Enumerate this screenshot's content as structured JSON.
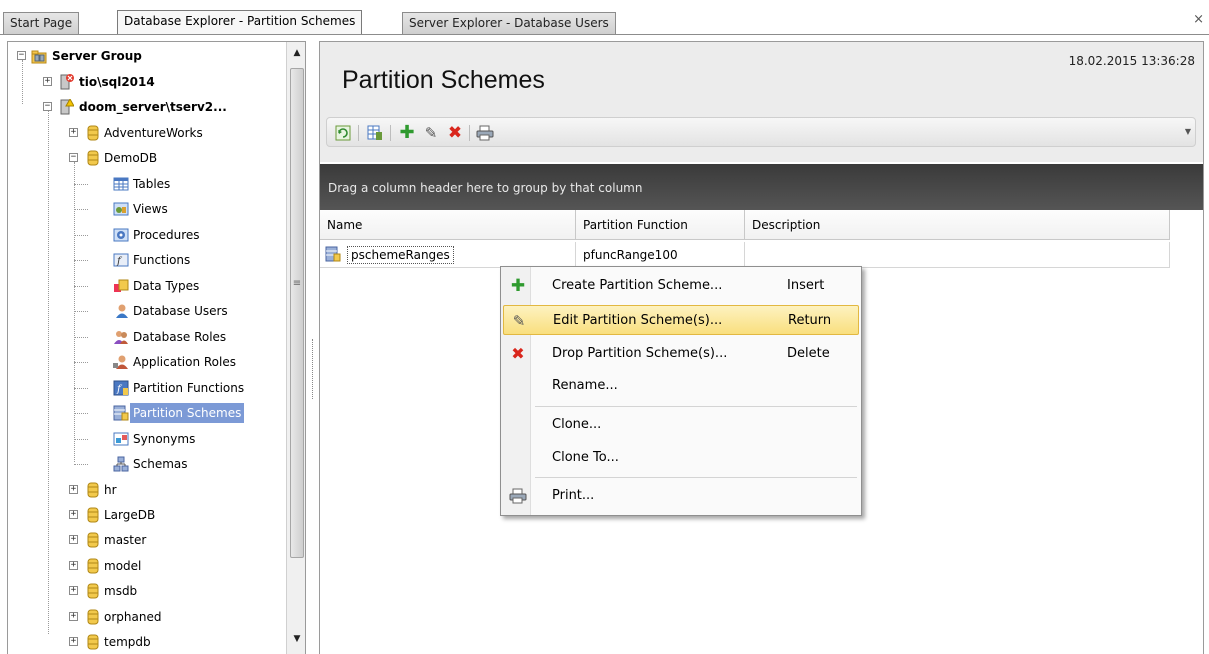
{
  "tabs": [
    {
      "label": "Start Page",
      "active": false
    },
    {
      "label": "Database Explorer - Partition Schemes",
      "active": true
    },
    {
      "label": "Server Explorer - Database Users",
      "active": false
    }
  ],
  "tab_close": "×",
  "tree": {
    "server_group": "Server Group",
    "servers": [
      "tio\\sql2014",
      "doom_server\\tserv2..."
    ],
    "databases_before": [
      "AdventureWorks",
      "DemoDB"
    ],
    "demodb_children": [
      "Tables",
      "Views",
      "Procedures",
      "Functions",
      "Data Types",
      "Database Users",
      "Database Roles",
      "Application Roles",
      "Partition Functions",
      "Partition Schemes",
      "Synonyms",
      "Schemas"
    ],
    "databases_after": [
      "hr",
      "LargeDB",
      "master",
      "model",
      "msdb",
      "orphaned",
      "tempdb"
    ],
    "selected": "Partition Schemes"
  },
  "header": {
    "title": "Partition Schemes",
    "timestamp": "18.02.2015 13:36:28"
  },
  "toolbar": {
    "buttons": [
      "refresh-icon",
      "properties-icon",
      "add-icon",
      "edit-icon",
      "delete-icon",
      "print-icon"
    ]
  },
  "grid": {
    "group_hint": "Drag a column header here to group by that column",
    "columns": [
      "Name",
      "Partition Function",
      "Description"
    ],
    "rows": [
      {
        "name": "pschemeRanges",
        "partition_function": "pfuncRange100",
        "description": ""
      }
    ]
  },
  "context_menu": {
    "items": [
      {
        "label": "Create Partition Scheme...",
        "shortcut": "Insert",
        "icon": "add-icon"
      },
      {
        "label": "Edit Partition Scheme(s)...",
        "shortcut": "Return",
        "icon": "edit-icon",
        "highlighted": true
      },
      {
        "label": "Drop Partition Scheme(s)...",
        "shortcut": "Delete",
        "icon": "delete-icon"
      },
      {
        "label": "Rename...",
        "shortcut": ""
      },
      {
        "label": "Clone...",
        "shortcut": ""
      },
      {
        "label": "Clone To...",
        "shortcut": ""
      },
      {
        "label": "Print...",
        "shortcut": "",
        "icon": "print-icon"
      }
    ]
  },
  "colors": {
    "accent_selection": "#7c9ad6",
    "group_bar": "#444444",
    "menu_highlight": "#f9df7e",
    "add_green": "#2f9a2f",
    "delete_red": "#d9261c",
    "db_yellow": "#f2c94c"
  }
}
